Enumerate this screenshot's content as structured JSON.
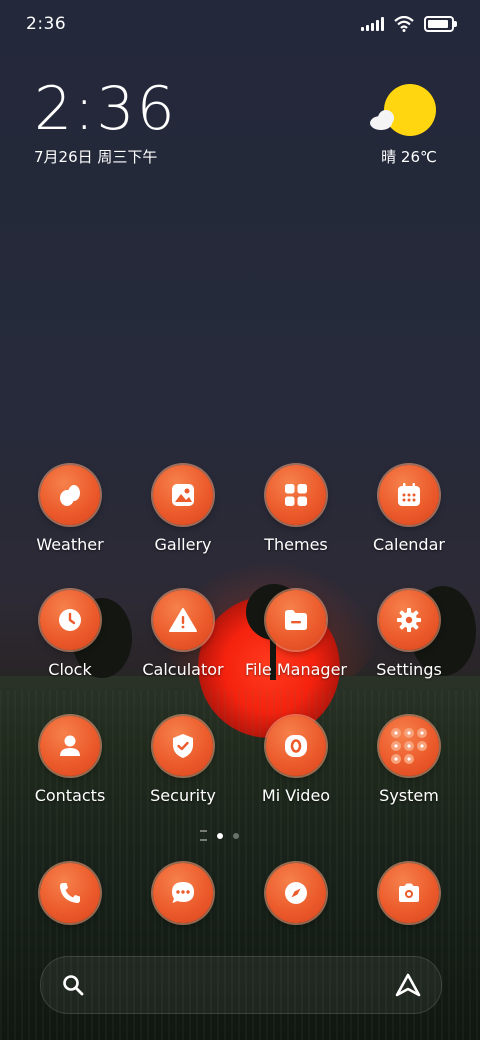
{
  "status_bar": {
    "time": "2:36"
  },
  "clock_widget": {
    "time": "2:36",
    "date": "7月26日 周三下午"
  },
  "weather_widget": {
    "text": "晴 26℃",
    "icon": "sun-cloud-icon"
  },
  "apps": [
    {
      "label": "Weather",
      "icon": "weather-icon"
    },
    {
      "label": "Gallery",
      "icon": "gallery-icon"
    },
    {
      "label": "Themes",
      "icon": "themes-icon"
    },
    {
      "label": "Calendar",
      "icon": "calendar-icon"
    },
    {
      "label": "Clock",
      "icon": "clock-icon"
    },
    {
      "label": "Calculator",
      "icon": "warning-icon"
    },
    {
      "label": "File Manager",
      "icon": "folder-icon"
    },
    {
      "label": "Settings",
      "icon": "gear-icon"
    },
    {
      "label": "Contacts",
      "icon": "contacts-icon"
    },
    {
      "label": "Security",
      "icon": "shield-icon"
    },
    {
      "label": "Mi Video",
      "icon": "video-icon"
    },
    {
      "label": "System",
      "icon": "folder-grid-icon"
    }
  ],
  "dock": [
    {
      "icon": "phone-icon"
    },
    {
      "icon": "message-icon"
    },
    {
      "icon": "compass-icon"
    },
    {
      "icon": "camera-icon"
    }
  ],
  "page_indicator": {
    "pages": 2,
    "active": 1
  },
  "colors": {
    "icon_bg": "#ec5b2c",
    "weather_sun": "#ffd60f"
  }
}
